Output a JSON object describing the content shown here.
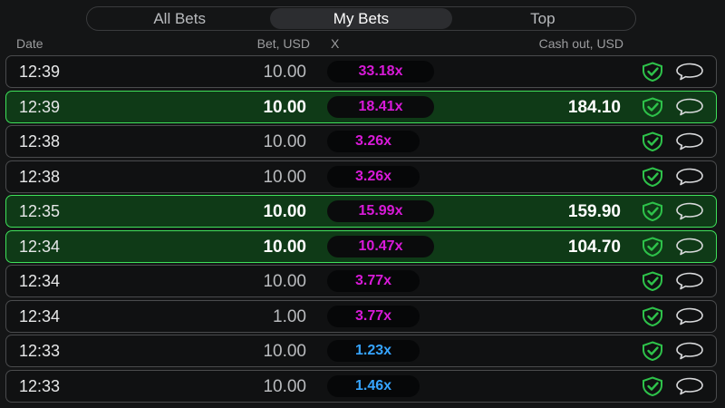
{
  "tabs": [
    {
      "label": "All Bets"
    },
    {
      "label": "My Bets",
      "active": true
    },
    {
      "label": "Top"
    }
  ],
  "header": {
    "date": "Date",
    "bet": "Bet, USD",
    "x": "X",
    "cashout": "Cash out, USD"
  },
  "colors": {
    "pink": "#d81ad8",
    "blue": "#36a4ff",
    "win_bg": "#0f3a17",
    "win_border": "#3fe05a",
    "shield": "#2ec24a"
  },
  "icons": {
    "verify": "shield-check-icon",
    "chat": "speech-bubble-icon"
  },
  "rows": [
    {
      "time": "12:39",
      "bet": "10.00",
      "mult": "33.18x",
      "cashout": "",
      "win": false,
      "mult_color": "#d81ad8"
    },
    {
      "time": "12:39",
      "bet": "10.00",
      "mult": "18.41x",
      "cashout": "184.10",
      "win": true,
      "mult_color": "#d81ad8"
    },
    {
      "time": "12:38",
      "bet": "10.00",
      "mult": "3.26x",
      "cashout": "",
      "win": false,
      "mult_color": "#d81ad8"
    },
    {
      "time": "12:38",
      "bet": "10.00",
      "mult": "3.26x",
      "cashout": "",
      "win": false,
      "mult_color": "#d81ad8"
    },
    {
      "time": "12:35",
      "bet": "10.00",
      "mult": "15.99x",
      "cashout": "159.90",
      "win": true,
      "mult_color": "#d81ad8"
    },
    {
      "time": "12:34",
      "bet": "10.00",
      "mult": "10.47x",
      "cashout": "104.70",
      "win": true,
      "mult_color": "#d81ad8"
    },
    {
      "time": "12:34",
      "bet": "10.00",
      "mult": "3.77x",
      "cashout": "",
      "win": false,
      "mult_color": "#d81ad8"
    },
    {
      "time": "12:34",
      "bet": "1.00",
      "mult": "3.77x",
      "cashout": "",
      "win": false,
      "mult_color": "#d81ad8"
    },
    {
      "time": "12:33",
      "bet": "10.00",
      "mult": "1.23x",
      "cashout": "",
      "win": false,
      "mult_color": "#36a4ff"
    },
    {
      "time": "12:33",
      "bet": "10.00",
      "mult": "1.46x",
      "cashout": "",
      "win": false,
      "mult_color": "#36a4ff"
    }
  ]
}
